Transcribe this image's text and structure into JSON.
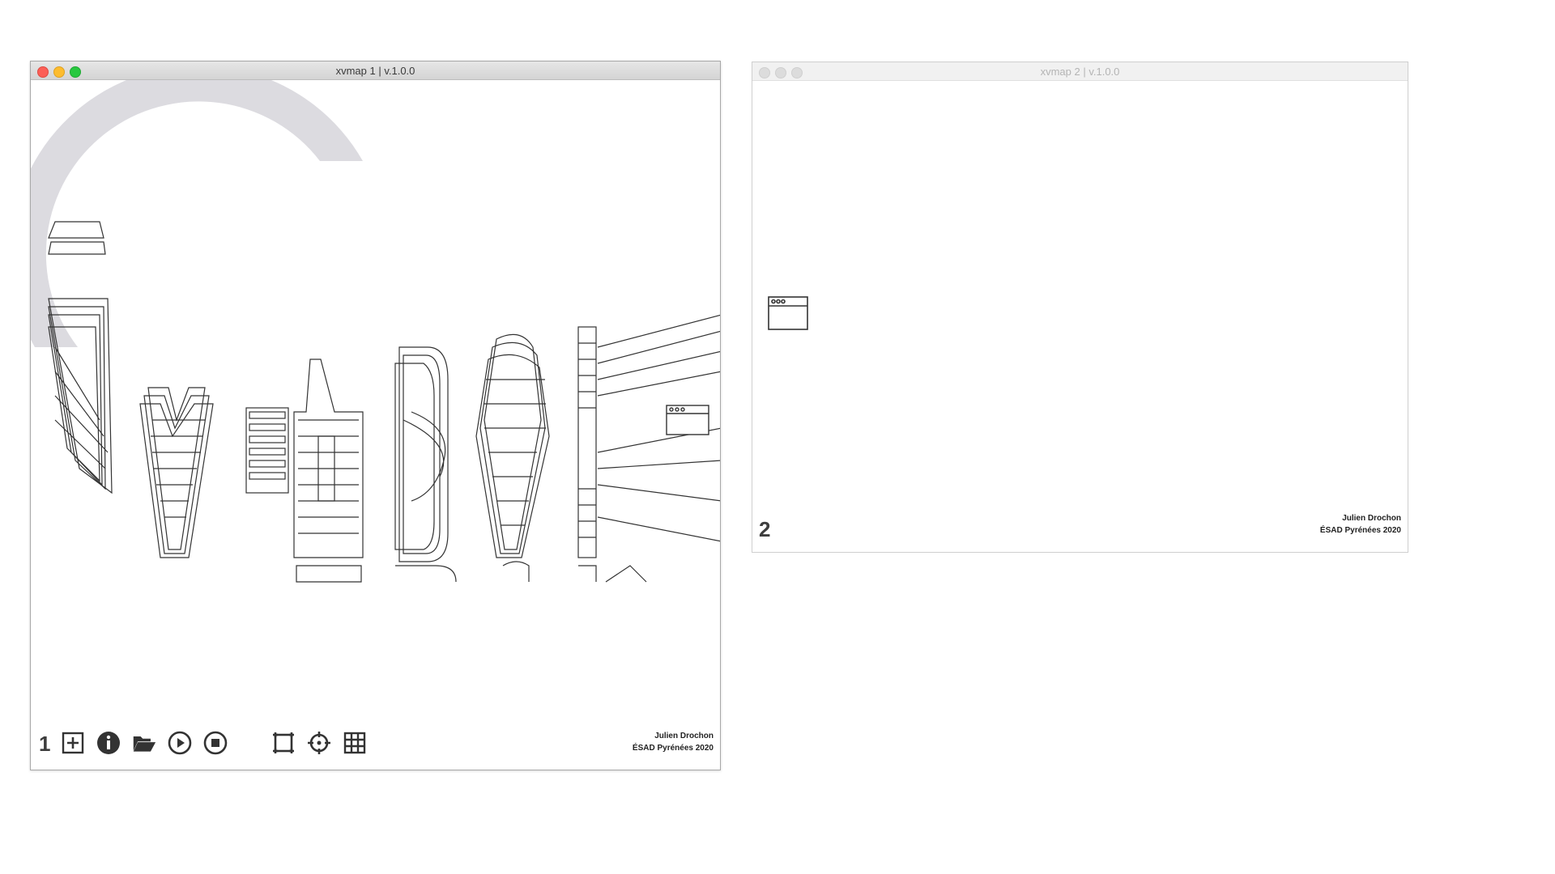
{
  "windows": [
    {
      "title": "xvmap 1 | v.1.0.0",
      "number": "1",
      "credits": {
        "line1": "Julien Drochon",
        "line2": "ÉSAD Pyrénées 2020"
      },
      "toolbar": [
        "add-icon",
        "info-icon",
        "folder-open-icon",
        "play-icon",
        "stop-icon",
        "crop-icon",
        "crosshair-icon",
        "grid-icon"
      ]
    },
    {
      "title": "xvmap 2 | v.1.0.0",
      "number": "2",
      "credits": {
        "line1": "Julien Drochon",
        "line2": "ÉSAD Pyrénées 2020"
      }
    }
  ],
  "colors": {
    "stroke": "#333333",
    "arc": "#dcdbe0",
    "active_red": "#fc5f57",
    "active_yellow": "#fdbc2e",
    "active_green": "#28c840"
  }
}
